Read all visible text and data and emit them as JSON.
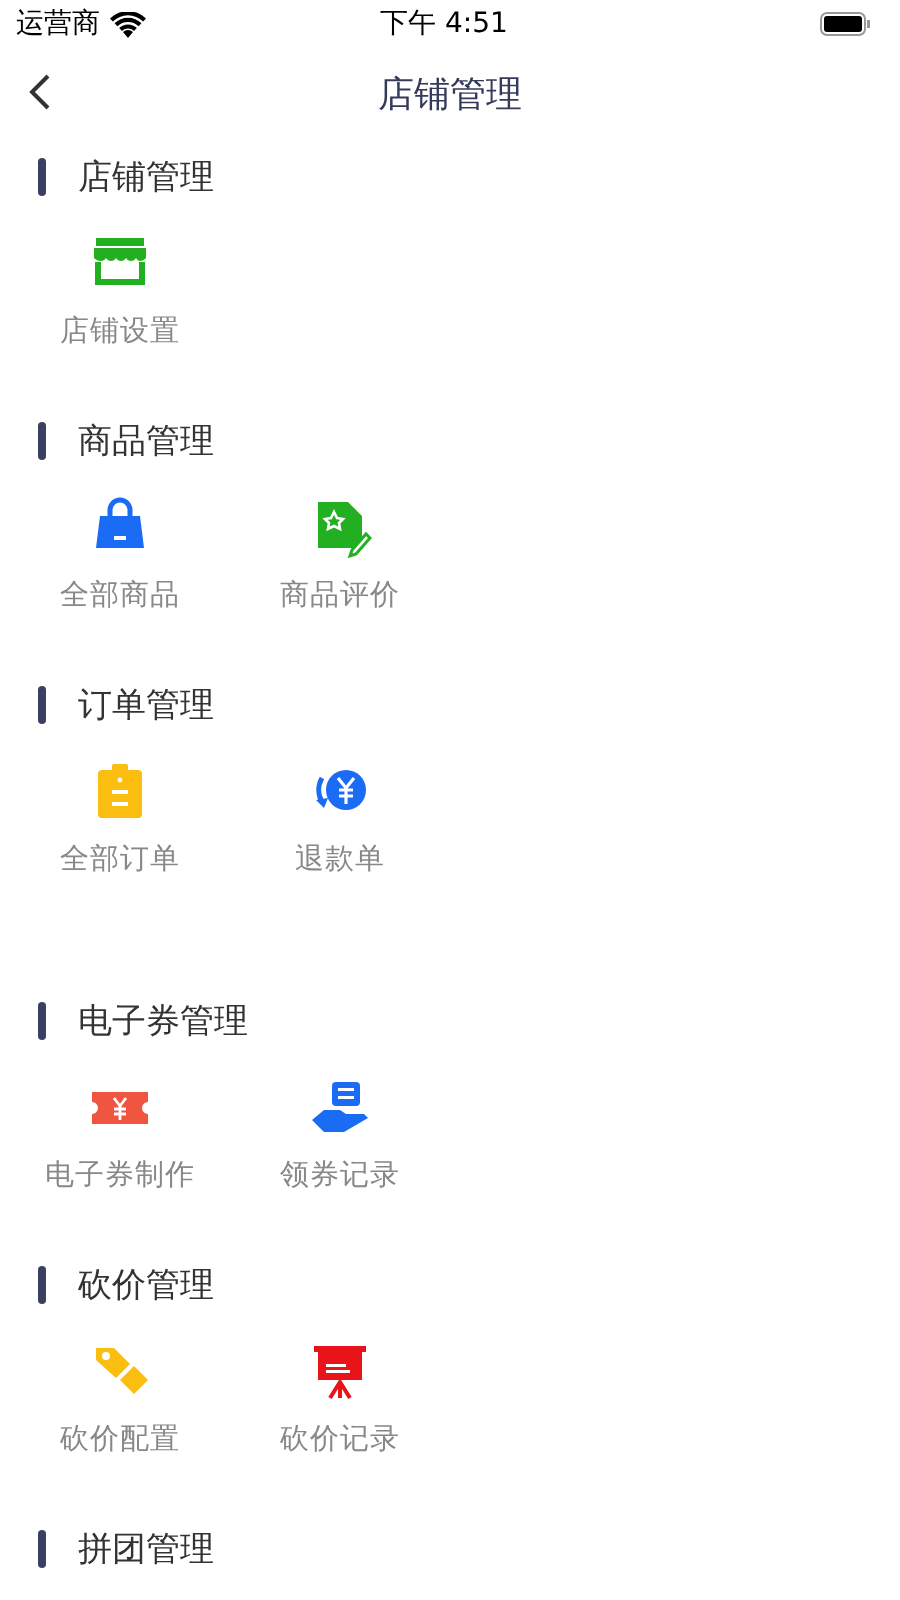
{
  "status_bar": {
    "carrier": "运营商",
    "time": "下午 4:51"
  },
  "nav": {
    "title": "店铺管理"
  },
  "sections": [
    {
      "title": "店铺管理",
      "items": [
        {
          "label": "店铺设置",
          "kind": "store"
        }
      ]
    },
    {
      "title": "商品管理",
      "items": [
        {
          "label": "全部商品",
          "kind": "bag"
        },
        {
          "label": "商品评价",
          "kind": "review"
        }
      ]
    },
    {
      "title": "订单管理",
      "items": [
        {
          "label": "全部订单",
          "kind": "clipboard"
        },
        {
          "label": "退款单",
          "kind": "refund"
        }
      ]
    },
    {
      "title": "电子券管理",
      "items": [
        {
          "label": "电子券制作",
          "kind": "ticket"
        },
        {
          "label": "领券记录",
          "kind": "receive"
        }
      ]
    },
    {
      "title": "砍价管理",
      "items": [
        {
          "label": "砍价配置",
          "kind": "tag"
        },
        {
          "label": "砍价记录",
          "kind": "board"
        }
      ]
    },
    {
      "title": "拼团管理"
    }
  ]
}
